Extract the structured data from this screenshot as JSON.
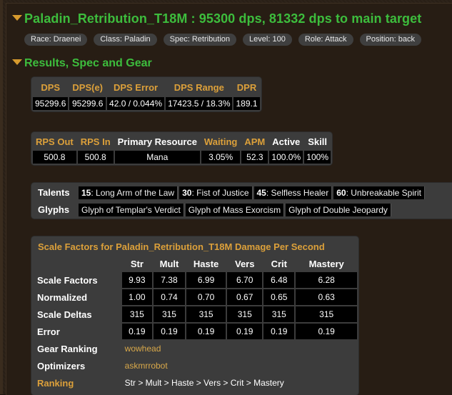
{
  "header": {
    "title": "Paladin_Retribution_T18M : 95300 dps, 81332 dps to main target",
    "pills": [
      "Race: Draenei",
      "Class: Paladin",
      "Spec: Retribution",
      "Level: 100",
      "Role: Attack",
      "Position: back"
    ]
  },
  "section": {
    "title": "Results, Spec and Gear"
  },
  "dps_table": {
    "headers": [
      "DPS",
      "DPS(e)",
      "DPS Error",
      "DPS Range",
      "DPR"
    ],
    "values": [
      "95299.6",
      "95299.6",
      "42.0 / 0.044%",
      "17423.5 / 18.3%",
      "189.1"
    ]
  },
  "resource_table": {
    "headers": [
      "RPS Out",
      "RPS In",
      "Primary Resource",
      "Waiting",
      "APM",
      "Active",
      "Skill"
    ],
    "values": [
      "500.8",
      "500.8",
      "Mana",
      "3.05%",
      "52.3",
      "100.0%",
      "100%"
    ]
  },
  "talents": {
    "label": "Talents",
    "items": [
      {
        "level": "15",
        "name": ": Long Arm of the Law"
      },
      {
        "level": "30",
        "name": ": Fist of Justice"
      },
      {
        "level": "45",
        "name": ": Selfless Healer"
      },
      {
        "level": "60",
        "name": ": Unbreakable Spirit"
      }
    ]
  },
  "glyphs": {
    "label": "Glyphs",
    "items": [
      "Glyph of Templar's Verdict",
      "Glyph of Mass Exorcism",
      "Glyph of Double Jeopardy"
    ]
  },
  "scale_factors": {
    "title": "Scale Factors for Paladin_Retribution_T18M Damage Per Second",
    "columns": [
      "Str",
      "Mult",
      "Haste",
      "Vers",
      "Crit",
      "Mastery"
    ],
    "rows": [
      {
        "label": "Scale Factors",
        "values": [
          "9.93",
          "7.38",
          "6.99",
          "6.70",
          "6.48",
          "6.28"
        ]
      },
      {
        "label": "Normalized",
        "values": [
          "1.00",
          "0.74",
          "0.70",
          "0.67",
          "0.65",
          "0.63"
        ]
      },
      {
        "label": "Scale Deltas",
        "values": [
          "315",
          "315",
          "315",
          "315",
          "315",
          "315"
        ]
      },
      {
        "label": "Error",
        "values": [
          "0.19",
          "0.19",
          "0.19",
          "0.19",
          "0.19",
          "0.19"
        ]
      }
    ],
    "gear_ranking": {
      "label": "Gear Ranking",
      "link": "wowhead"
    },
    "optimizers": {
      "label": "Optimizers",
      "link": "askmrrobot"
    },
    "ranking": {
      "label": "Ranking",
      "value": "Str > Mult > Haste > Vers > Crit > Mastery"
    }
  },
  "colors": {
    "title_green": "#3dbd3d",
    "accent_orange": "#dca03a",
    "link_gold": "#d8a84a"
  }
}
